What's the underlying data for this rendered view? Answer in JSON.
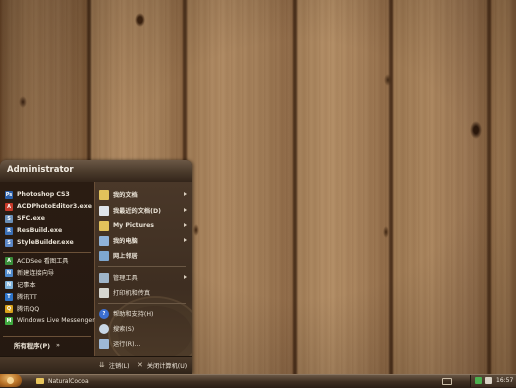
{
  "start_menu": {
    "user": "Administrator",
    "pinned": [
      {
        "label": "Photoshop CS3",
        "icon": "photoshop-icon",
        "color": "#2a5ea8",
        "glyph": "Ps"
      },
      {
        "label": "ACDPhotoEditor3.exe",
        "icon": "acdsee-editor-icon",
        "color": "#c73a2a",
        "glyph": "A"
      },
      {
        "label": "SFC.exe",
        "icon": "sfc-icon",
        "color": "#6a8fb8",
        "glyph": "S"
      },
      {
        "label": "ResBuild.exe",
        "icon": "resbuild-icon",
        "color": "#3b6fb5",
        "glyph": "R"
      },
      {
        "label": "StyleBuilder.exe",
        "icon": "stylebuilder-icon",
        "color": "#5a86c5",
        "glyph": "S"
      }
    ],
    "recent": [
      {
        "label": "ACDSee 看图工具",
        "icon": "acdsee-icon",
        "color": "#3a8e3a",
        "glyph": "A"
      },
      {
        "label": "新建连接向导",
        "icon": "network-wizard-icon",
        "color": "#4e88c9",
        "glyph": "N"
      },
      {
        "label": "记事本",
        "icon": "notepad-icon",
        "color": "#7fb2d9",
        "glyph": "N"
      },
      {
        "label": "腾讯TT",
        "icon": "tencent-tt-icon",
        "color": "#2f74c8",
        "glyph": "T"
      },
      {
        "label": "腾讯QQ",
        "icon": "qq-icon",
        "color": "#d8a21b",
        "glyph": "Q"
      },
      {
        "label": "Windows Live Messenger",
        "icon": "messenger-icon",
        "color": "#3faa3f",
        "glyph": "M"
      }
    ],
    "all_programs": "所有程序(P)",
    "all_programs_arrow": "»",
    "right_group1": [
      {
        "label": "我的文档",
        "icon": "my-documents-icon",
        "color": "#e2c25b",
        "arrow": true
      },
      {
        "label": "我最近的文档(D)",
        "icon": "recent-documents-icon",
        "color": "#dfe4ea",
        "arrow": true
      },
      {
        "label": "My Pictures",
        "icon": "my-pictures-icon",
        "color": "#e2c25b",
        "arrow": true
      },
      {
        "label": "我的电脑",
        "icon": "my-computer-icon",
        "color": "#8fb3d9",
        "arrow": true
      },
      {
        "label": "网上邻居",
        "icon": "network-places-icon",
        "color": "#7ea7cf",
        "arrow": false
      }
    ],
    "right_group2": [
      {
        "label": "管理工具",
        "icon": "admin-tools-icon",
        "color": "#9fb5c9",
        "arrow": true
      },
      {
        "label": "打印机和传真",
        "icon": "printers-icon",
        "color": "#d7d7d0",
        "arrow": false
      }
    ],
    "right_group3": [
      {
        "label": "帮助和支持(H)",
        "icon": "help-icon",
        "color": "#3b6fd1",
        "arrow": false
      },
      {
        "label": "搜索(S)",
        "icon": "search-icon",
        "color": "#c9d7e6",
        "arrow": false
      },
      {
        "label": "运行(R)...",
        "icon": "run-icon",
        "color": "#9eb9d7",
        "arrow": false
      }
    ],
    "footer": {
      "logoff_label": "注销(L)",
      "shutdown_label": "关闭计算机(U)"
    }
  },
  "taskbar": {
    "active_window": "NaturalCocoa",
    "clock": "16:57"
  }
}
